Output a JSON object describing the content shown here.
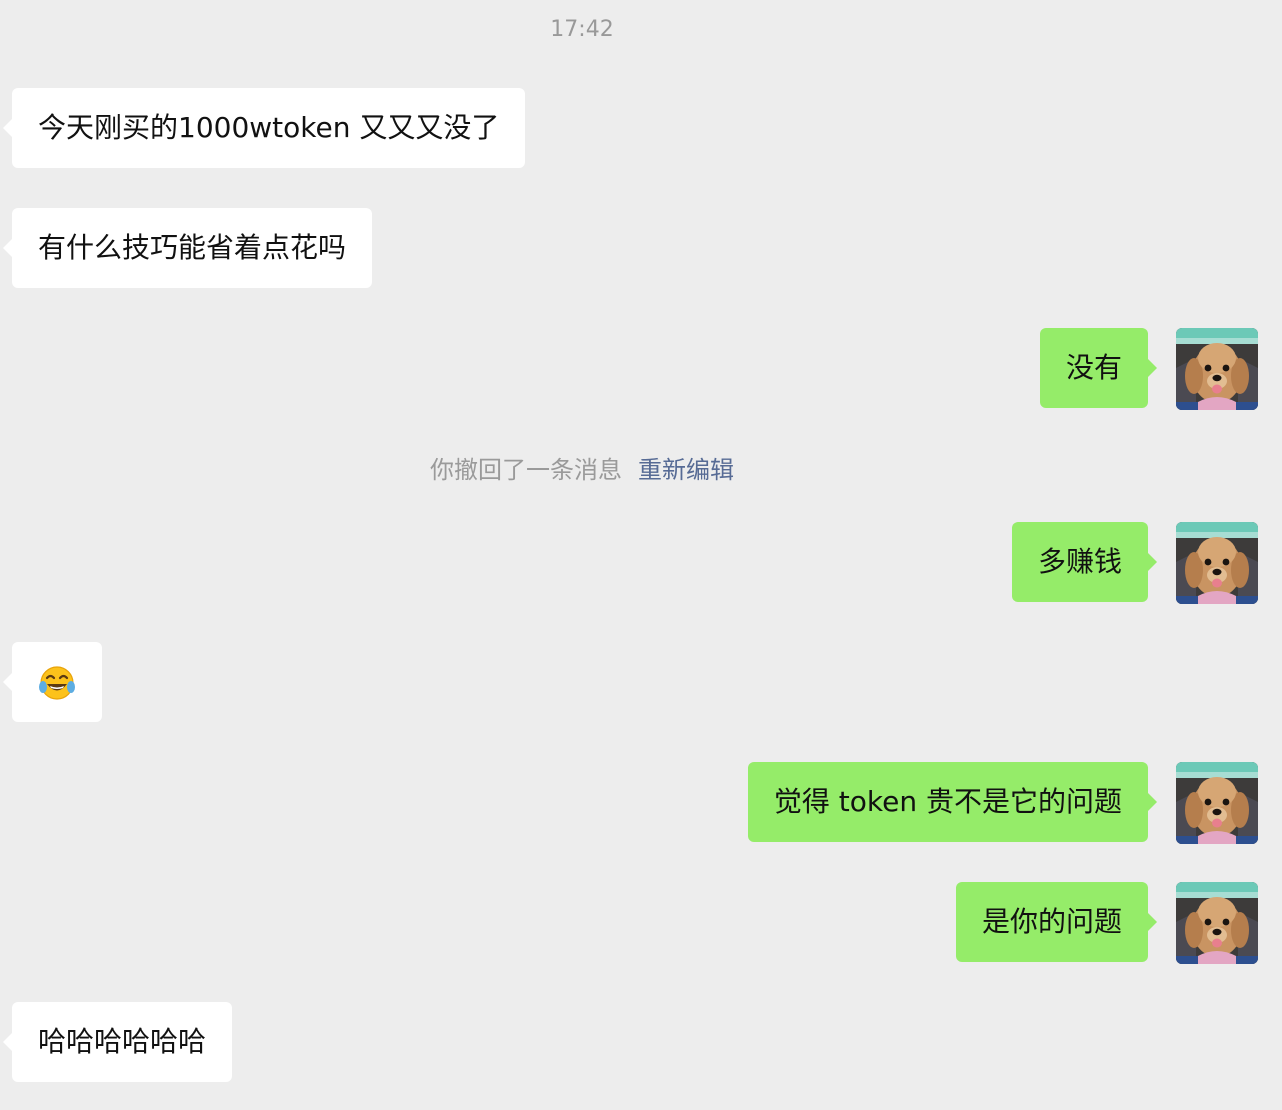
{
  "chat": {
    "timestamp": "17:42",
    "recall_notice": {
      "text": "你撤回了一条消息",
      "action_label": "重新编辑"
    },
    "messages": [
      {
        "side": "left",
        "type": "text",
        "text": "今天刚买的1000wtoken 又又又没了"
      },
      {
        "side": "left",
        "type": "text",
        "text": "有什么技巧能省着点花吗"
      },
      {
        "side": "right",
        "type": "text",
        "text": "没有"
      },
      {
        "side": "right",
        "type": "text",
        "text": "多赚钱"
      },
      {
        "side": "left",
        "type": "emoji",
        "emoji": "laughing-tears-emoji"
      },
      {
        "side": "right",
        "type": "text",
        "text": "觉得 token 贵不是它的问题"
      },
      {
        "side": "right",
        "type": "text",
        "text": "是你的问题"
      },
      {
        "side": "left",
        "type": "text",
        "text": "哈哈哈哈哈哈"
      }
    ],
    "avatar": {
      "icon": "dog-avatar-icon"
    },
    "colors": {
      "background": "#ededed",
      "incoming_bubble": "#ffffff",
      "outgoing_bubble": "#95ec69",
      "link": "#576b95"
    }
  }
}
